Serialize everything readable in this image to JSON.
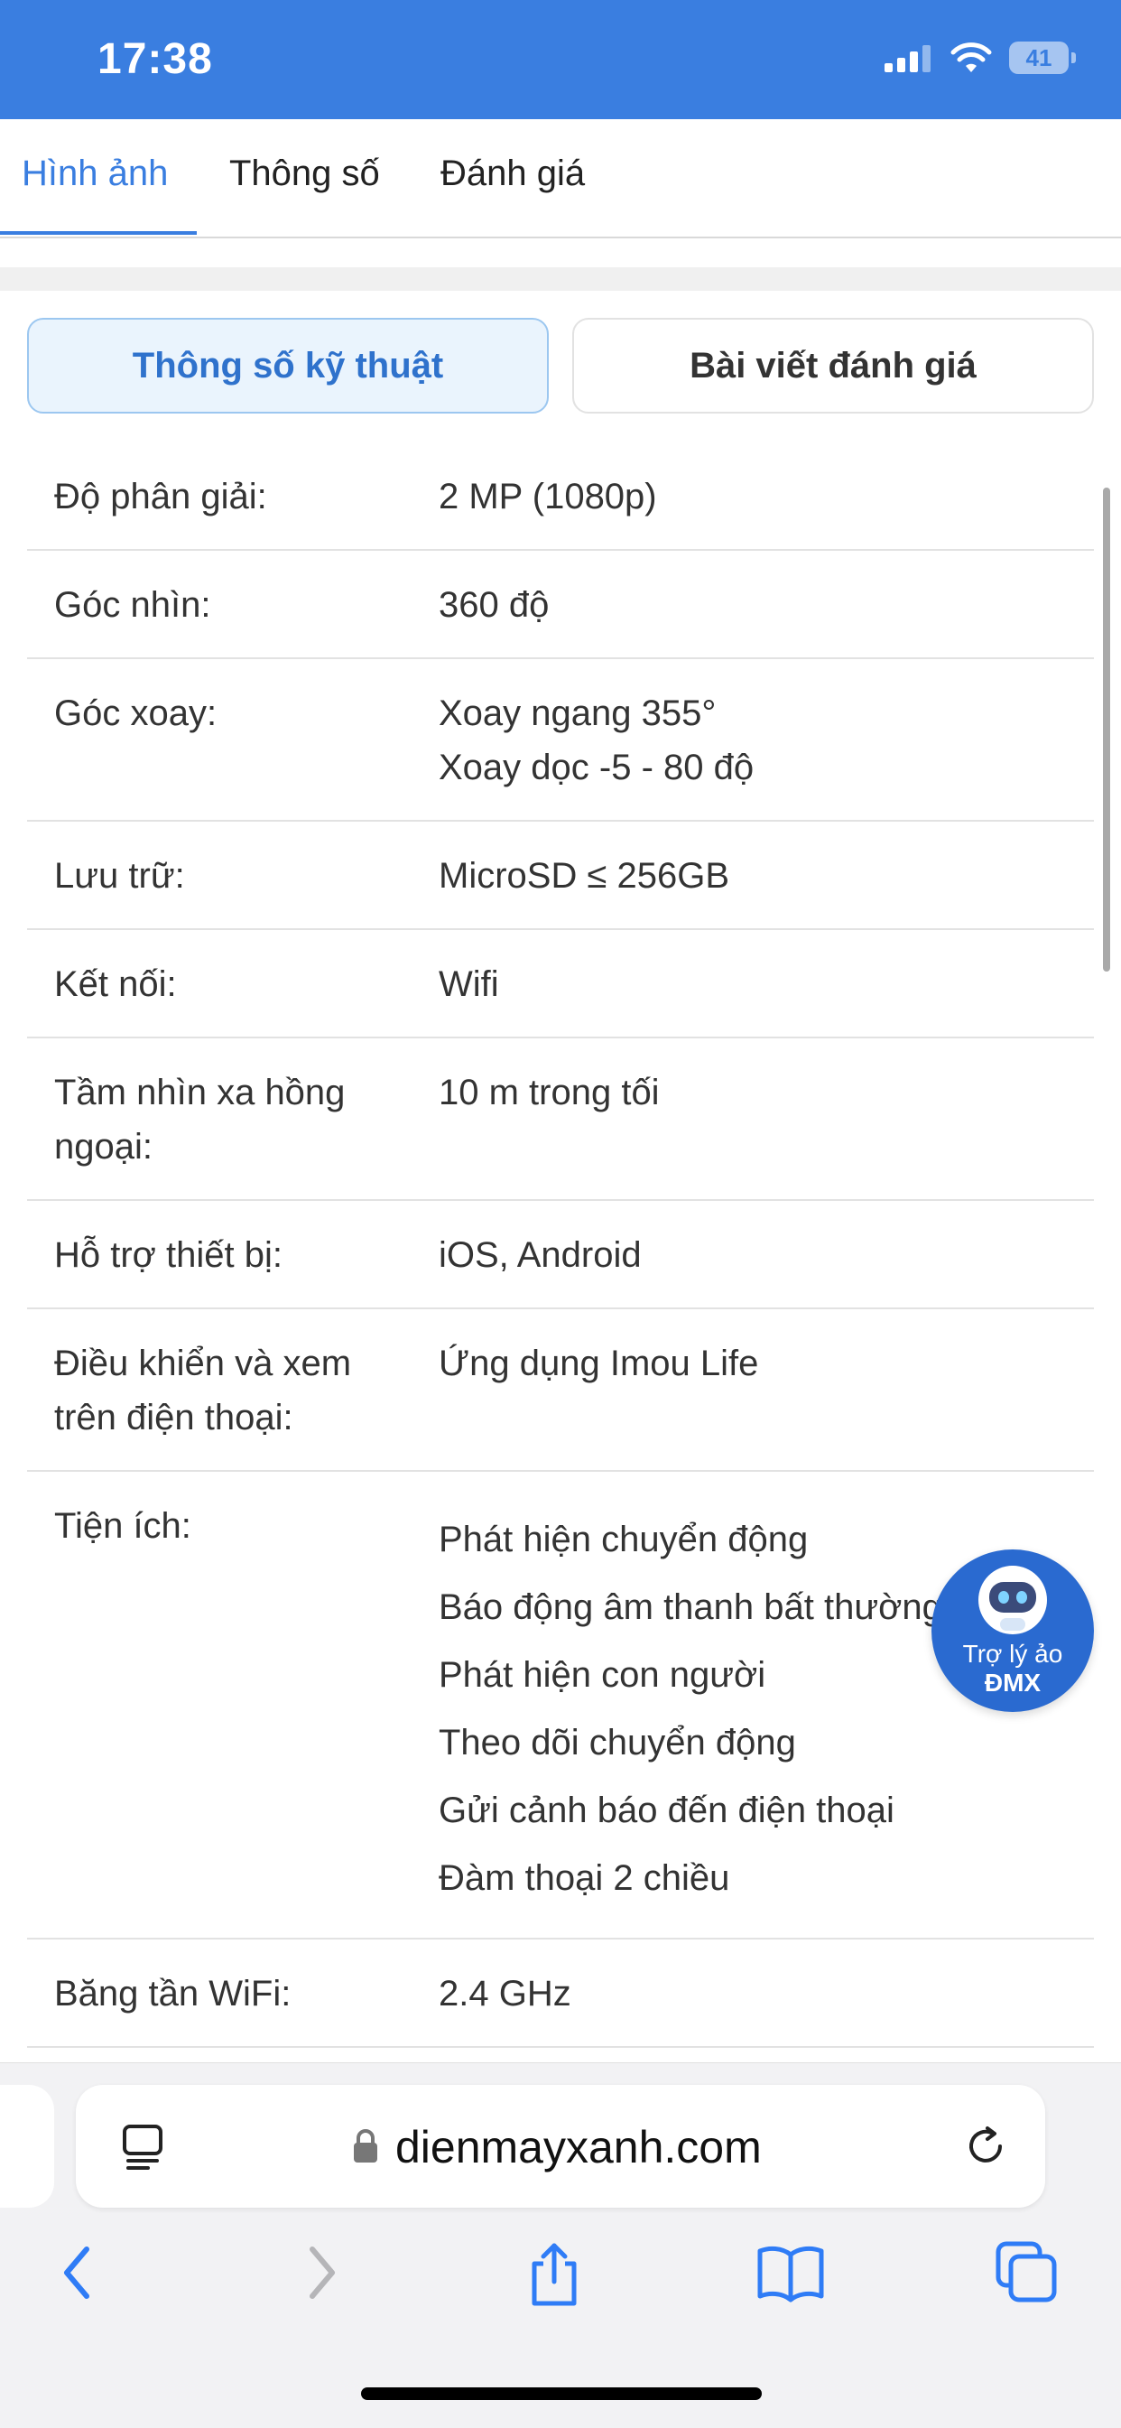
{
  "status": {
    "time": "17:38",
    "battery": "41"
  },
  "tabs": [
    "Hình ảnh",
    "Thông số",
    "Đánh giá"
  ],
  "segment": {
    "active": "Thông số kỹ thuật",
    "inactive": "Bài viết đánh giá"
  },
  "specs": [
    {
      "label": "Độ phân giải:",
      "values": [
        "2 MP (1080p)"
      ]
    },
    {
      "label": "Góc nhìn:",
      "values": [
        "360 độ"
      ]
    },
    {
      "label": "Góc xoay:",
      "values": [
        "Xoay ngang 355°",
        "Xoay dọc -5 - 80 độ"
      ]
    },
    {
      "label": "Lưu trữ:",
      "values": [
        "MicroSD ≤ 256GB"
      ]
    },
    {
      "label": "Kết nối:",
      "values": [
        "Wifi"
      ]
    },
    {
      "label": "Tầm nhìn xa hồng ngoại:",
      "values": [
        "10 m trong tối"
      ]
    },
    {
      "label": "Hỗ trợ thiết bị:",
      "values": [
        "iOS, Android"
      ]
    },
    {
      "label": "Điều khiển và xem trên điện thoại:",
      "values": [
        "Ứng dụng Imou Life"
      ]
    },
    {
      "label": "Tiện ích:",
      "values": [
        "Phát hiện chuyển động",
        "Báo động âm thanh bất thường",
        "Phát hiện con người",
        "Theo dõi chuyển động",
        "Gửi cảnh báo đến điện thoại",
        "Đàm thoại 2 chiều"
      ]
    },
    {
      "label": "Băng tần WiFi:",
      "values": [
        "2.4 GHz"
      ]
    }
  ],
  "assistant": {
    "line1": "Trợ lý ảo",
    "line2": "ĐMX"
  },
  "browser": {
    "url": "dienmayxanh.com"
  },
  "colors": {
    "accent": "#3a7ee0",
    "assistant": "#2a6ad0"
  }
}
